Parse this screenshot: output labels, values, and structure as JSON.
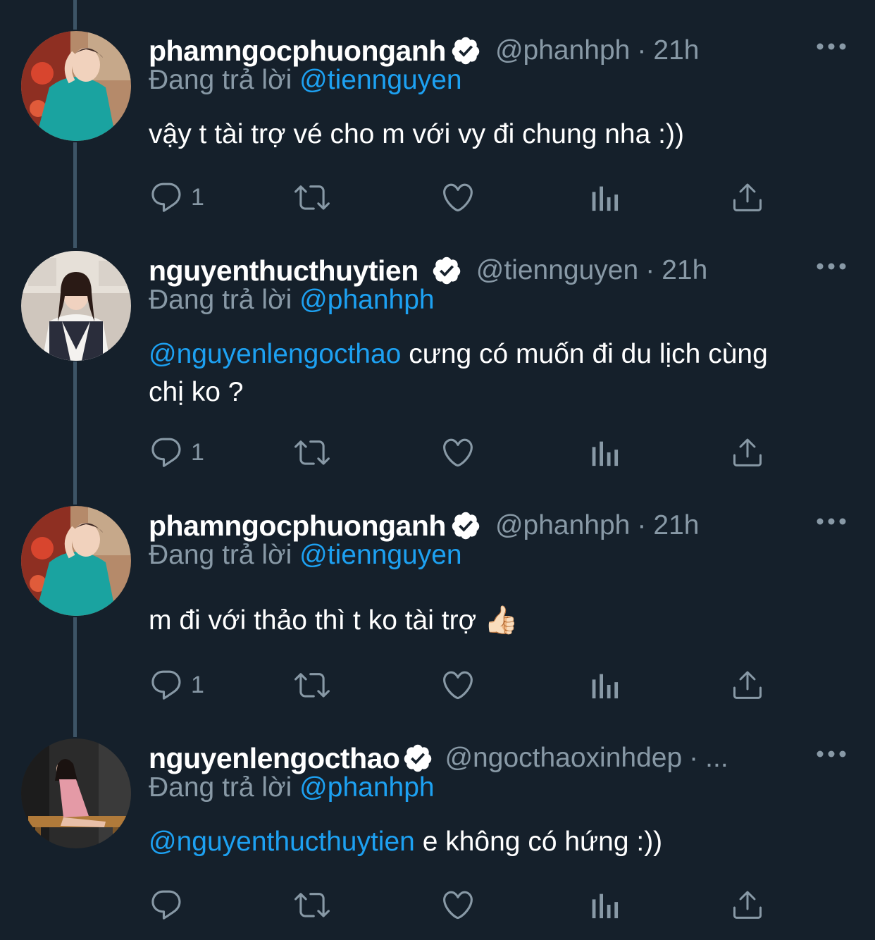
{
  "colors": {
    "background": "#15202b",
    "text_primary": "#ffffff",
    "text_secondary": "#8899a6",
    "accent": "#1da1f2",
    "thread_line": "#3d5466"
  },
  "tweets": [
    {
      "display_name": "phamngocphuonganh",
      "verified_icon": "verified-badge-icon",
      "handle": "@phanhph",
      "separator": "·",
      "time": "21h",
      "replying_label": "Đang trả lời",
      "replying_to": "@tiennguyen",
      "mention": "",
      "body": "vậy t tài trợ vé cho m với vy đi chung nha :))",
      "reply_count": "1"
    },
    {
      "display_name": "nguyenthucthuytien",
      "verified_icon": "verified-badge-icon",
      "handle": "@tiennguyen",
      "separator": "·",
      "time": "21h",
      "replying_label": "Đang trả lời",
      "replying_to": "@phanhph",
      "mention": "@nguyenlengocthao",
      "body": " cưng có muốn đi du lịch cùng chị ko ?",
      "reply_count": "1"
    },
    {
      "display_name": "phamngocphuonganh",
      "verified_icon": "verified-badge-icon",
      "handle": "@phanhph",
      "separator": "·",
      "time": "21h",
      "replying_label": "Đang trả lời",
      "replying_to": "@tiennguyen",
      "mention": "",
      "body": "m đi với thảo thì t ko tài trợ 👍🏻",
      "reply_count": "1"
    },
    {
      "display_name": "nguyenlengocthao",
      "verified_icon": "verified-badge-icon",
      "handle": "@ngocthaoxinhdep",
      "separator": "·",
      "time": "...",
      "replying_label": "Đang trả lời",
      "replying_to": "@phanhph",
      "mention": "@nguyenthucthuytien",
      "body": " e không có hứng :))",
      "reply_count": ""
    }
  ],
  "action_icons": [
    "reply-icon",
    "retweet-icon",
    "like-icon",
    "analytics-icon",
    "share-icon"
  ],
  "more_icon": "more-options-icon"
}
